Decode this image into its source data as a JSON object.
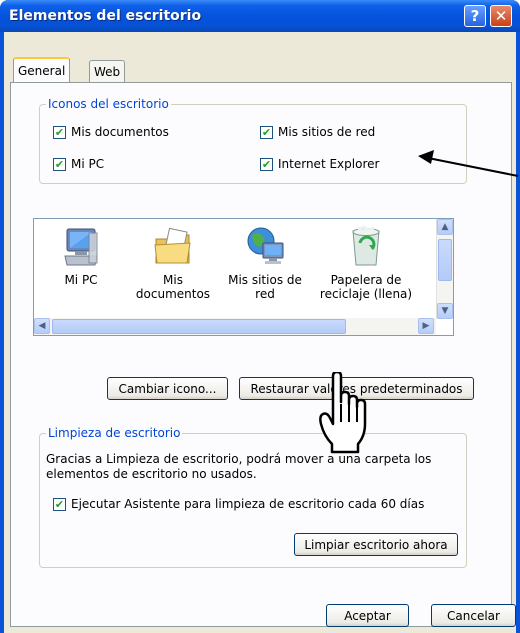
{
  "window": {
    "title": "Elementos del escritorio",
    "help_label": "?",
    "close_label": "✕"
  },
  "tabs": [
    {
      "label": "General",
      "active": true
    },
    {
      "label": "Web",
      "active": false
    }
  ],
  "desktop_icons_group": {
    "legend": "Iconos del escritorio",
    "checkboxes": [
      {
        "label": "Mis documentos",
        "checked": true
      },
      {
        "label": "Mis sitios de red",
        "checked": true
      },
      {
        "label": "Mi PC",
        "checked": true
      },
      {
        "label": "Internet Explorer",
        "checked": true
      }
    ]
  },
  "icon_list": {
    "items": [
      {
        "label_line1": "Mi PC",
        "label_line2": "",
        "icon": "my-computer-icon"
      },
      {
        "label_line1": "Mis",
        "label_line2": "documentos",
        "icon": "my-documents-icon"
      },
      {
        "label_line1": "Mis sitios de",
        "label_line2": "red",
        "icon": "network-places-icon"
      },
      {
        "label_line1": "Papelera de",
        "label_line2": "reciclaje (llena)",
        "icon": "recycle-bin-full-icon"
      }
    ]
  },
  "buttons": {
    "change_icon": "Cambiar icono...",
    "restore_defaults": "Restaurar valores predeterminados",
    "clean_now": "Limpiar escritorio ahora",
    "ok": "Aceptar",
    "cancel": "Cancelar"
  },
  "cleanup_group": {
    "legend": "Limpieza de escritorio",
    "description_line1": "Gracias a Limpieza de escritorio, podrá mover a una carpeta los",
    "description_line2": "elementos de escritorio no usados.",
    "run_wizard_label": "Ejecutar Asistente para limpieza de escritorio cada 60 días",
    "run_wizard_checked": true
  },
  "colors": {
    "titlebar": "#0553dd",
    "dialog_bg": "#ece9d8",
    "group_legend": "#0046d5"
  }
}
